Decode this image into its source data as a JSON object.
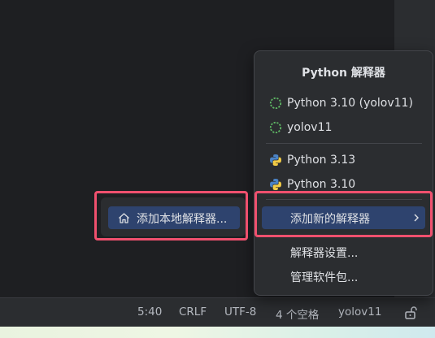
{
  "status_bar": {
    "position": "5:40",
    "line_ending": "CRLF",
    "encoding": "UTF-8",
    "indent": "4 个空格",
    "interpreter": "yolov11"
  },
  "interpreter_popup": {
    "title": "Python 解释器",
    "envs": [
      {
        "label": "Python 3.10 (yolov11)",
        "icon": "spinner-icon"
      },
      {
        "label": "yolov11",
        "icon": "spinner-icon"
      }
    ],
    "interpreters": [
      {
        "label": "Python 3.13",
        "icon": "python-icon"
      },
      {
        "label": "Python 3.10",
        "icon": "python-icon"
      }
    ],
    "add_new_label": "添加新的解释器",
    "settings_label": "解释器设置...",
    "manage_packages_label": "管理软件包..."
  },
  "submenu": {
    "add_local_label": "添加本地解释器..."
  },
  "colors": {
    "highlight": "#f0506e",
    "selection": "#2e436e",
    "popup_bg": "#2b2d30",
    "editor_bg": "#1e1f22"
  }
}
